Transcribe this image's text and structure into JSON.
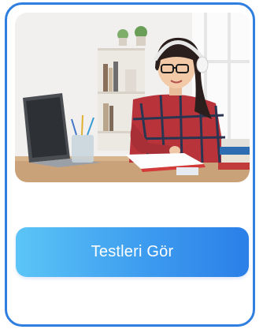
{
  "card": {
    "border_color": "#2f7fe0",
    "image": {
      "subject": "student-studying-photo"
    },
    "button": {
      "label": "Testleri Gör",
      "gradient_start": "#5cc5f6",
      "gradient_end": "#2b7fe8"
    }
  }
}
